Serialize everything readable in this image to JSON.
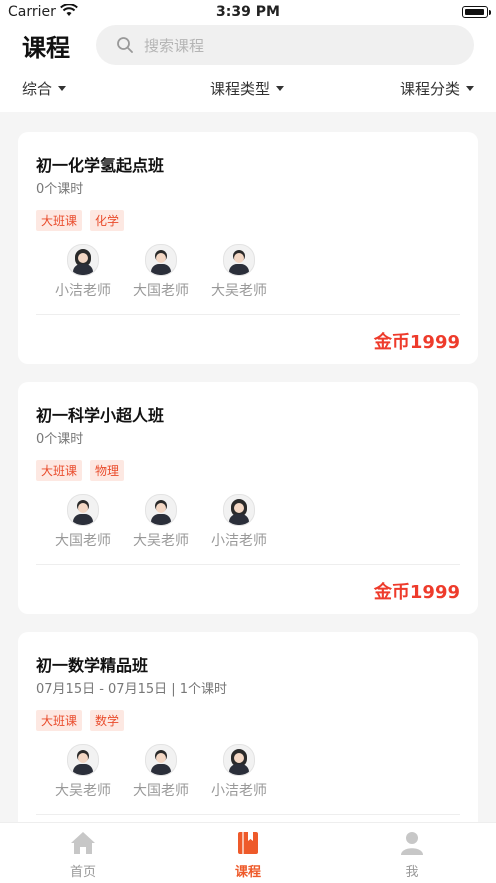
{
  "status_bar": {
    "carrier": "Carrier",
    "time": "3:39 PM"
  },
  "header": {
    "title": "课程",
    "search_placeholder": "搜索课程"
  },
  "filters": [
    "综合",
    "课程类型",
    "课程分类"
  ],
  "courses": [
    {
      "title": "初一化学氢起点班",
      "meta": "0个课时",
      "tags": [
        "大班课",
        "化学"
      ],
      "teachers": [
        "小洁老师",
        "大国老师",
        "大吴老师"
      ],
      "price": "金币1999"
    },
    {
      "title": "初一科学小超人班",
      "meta": "0个课时",
      "tags": [
        "大班课",
        "物理"
      ],
      "teachers": [
        "大国老师",
        "大吴老师",
        "小洁老师"
      ],
      "price": "金币1999"
    },
    {
      "title": "初一数学精品班",
      "meta": "07月15日 - 07月15日 | 1个课时",
      "tags": [
        "大班课",
        "数学"
      ],
      "teachers": [
        "大吴老师",
        "大国老师",
        "小洁老师"
      ]
    }
  ],
  "tabbar": {
    "home": "首页",
    "course": "课程",
    "me": "我"
  },
  "colors": {
    "accent": "#ee3b2b",
    "tag_bg": "#fde8e2",
    "active_tab": "#ee5a2a"
  }
}
